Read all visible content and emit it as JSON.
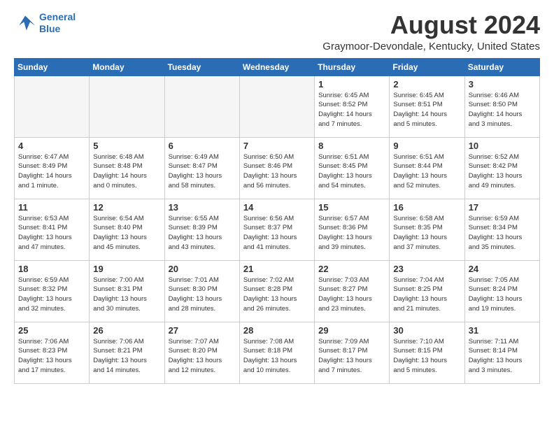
{
  "logo": {
    "line1": "General",
    "line2": "Blue"
  },
  "title": "August 2024",
  "subtitle": "Graymoor-Devondale, Kentucky, United States",
  "days_of_week": [
    "Sunday",
    "Monday",
    "Tuesday",
    "Wednesday",
    "Thursday",
    "Friday",
    "Saturday"
  ],
  "weeks": [
    [
      {
        "day": "",
        "info": ""
      },
      {
        "day": "",
        "info": ""
      },
      {
        "day": "",
        "info": ""
      },
      {
        "day": "",
        "info": ""
      },
      {
        "day": "1",
        "info": "Sunrise: 6:45 AM\nSunset: 8:52 PM\nDaylight: 14 hours\nand 7 minutes."
      },
      {
        "day": "2",
        "info": "Sunrise: 6:45 AM\nSunset: 8:51 PM\nDaylight: 14 hours\nand 5 minutes."
      },
      {
        "day": "3",
        "info": "Sunrise: 6:46 AM\nSunset: 8:50 PM\nDaylight: 14 hours\nand 3 minutes."
      }
    ],
    [
      {
        "day": "4",
        "info": "Sunrise: 6:47 AM\nSunset: 8:49 PM\nDaylight: 14 hours\nand 1 minute."
      },
      {
        "day": "5",
        "info": "Sunrise: 6:48 AM\nSunset: 8:48 PM\nDaylight: 14 hours\nand 0 minutes."
      },
      {
        "day": "6",
        "info": "Sunrise: 6:49 AM\nSunset: 8:47 PM\nDaylight: 13 hours\nand 58 minutes."
      },
      {
        "day": "7",
        "info": "Sunrise: 6:50 AM\nSunset: 8:46 PM\nDaylight: 13 hours\nand 56 minutes."
      },
      {
        "day": "8",
        "info": "Sunrise: 6:51 AM\nSunset: 8:45 PM\nDaylight: 13 hours\nand 54 minutes."
      },
      {
        "day": "9",
        "info": "Sunrise: 6:51 AM\nSunset: 8:44 PM\nDaylight: 13 hours\nand 52 minutes."
      },
      {
        "day": "10",
        "info": "Sunrise: 6:52 AM\nSunset: 8:42 PM\nDaylight: 13 hours\nand 49 minutes."
      }
    ],
    [
      {
        "day": "11",
        "info": "Sunrise: 6:53 AM\nSunset: 8:41 PM\nDaylight: 13 hours\nand 47 minutes."
      },
      {
        "day": "12",
        "info": "Sunrise: 6:54 AM\nSunset: 8:40 PM\nDaylight: 13 hours\nand 45 minutes."
      },
      {
        "day": "13",
        "info": "Sunrise: 6:55 AM\nSunset: 8:39 PM\nDaylight: 13 hours\nand 43 minutes."
      },
      {
        "day": "14",
        "info": "Sunrise: 6:56 AM\nSunset: 8:37 PM\nDaylight: 13 hours\nand 41 minutes."
      },
      {
        "day": "15",
        "info": "Sunrise: 6:57 AM\nSunset: 8:36 PM\nDaylight: 13 hours\nand 39 minutes."
      },
      {
        "day": "16",
        "info": "Sunrise: 6:58 AM\nSunset: 8:35 PM\nDaylight: 13 hours\nand 37 minutes."
      },
      {
        "day": "17",
        "info": "Sunrise: 6:59 AM\nSunset: 8:34 PM\nDaylight: 13 hours\nand 35 minutes."
      }
    ],
    [
      {
        "day": "18",
        "info": "Sunrise: 6:59 AM\nSunset: 8:32 PM\nDaylight: 13 hours\nand 32 minutes."
      },
      {
        "day": "19",
        "info": "Sunrise: 7:00 AM\nSunset: 8:31 PM\nDaylight: 13 hours\nand 30 minutes."
      },
      {
        "day": "20",
        "info": "Sunrise: 7:01 AM\nSunset: 8:30 PM\nDaylight: 13 hours\nand 28 minutes."
      },
      {
        "day": "21",
        "info": "Sunrise: 7:02 AM\nSunset: 8:28 PM\nDaylight: 13 hours\nand 26 minutes."
      },
      {
        "day": "22",
        "info": "Sunrise: 7:03 AM\nSunset: 8:27 PM\nDaylight: 13 hours\nand 23 minutes."
      },
      {
        "day": "23",
        "info": "Sunrise: 7:04 AM\nSunset: 8:25 PM\nDaylight: 13 hours\nand 21 minutes."
      },
      {
        "day": "24",
        "info": "Sunrise: 7:05 AM\nSunset: 8:24 PM\nDaylight: 13 hours\nand 19 minutes."
      }
    ],
    [
      {
        "day": "25",
        "info": "Sunrise: 7:06 AM\nSunset: 8:23 PM\nDaylight: 13 hours\nand 17 minutes."
      },
      {
        "day": "26",
        "info": "Sunrise: 7:06 AM\nSunset: 8:21 PM\nDaylight: 13 hours\nand 14 minutes."
      },
      {
        "day": "27",
        "info": "Sunrise: 7:07 AM\nSunset: 8:20 PM\nDaylight: 13 hours\nand 12 minutes."
      },
      {
        "day": "28",
        "info": "Sunrise: 7:08 AM\nSunset: 8:18 PM\nDaylight: 13 hours\nand 10 minutes."
      },
      {
        "day": "29",
        "info": "Sunrise: 7:09 AM\nSunset: 8:17 PM\nDaylight: 13 hours\nand 7 minutes."
      },
      {
        "day": "30",
        "info": "Sunrise: 7:10 AM\nSunset: 8:15 PM\nDaylight: 13 hours\nand 5 minutes."
      },
      {
        "day": "31",
        "info": "Sunrise: 7:11 AM\nSunset: 8:14 PM\nDaylight: 13 hours\nand 3 minutes."
      }
    ]
  ]
}
